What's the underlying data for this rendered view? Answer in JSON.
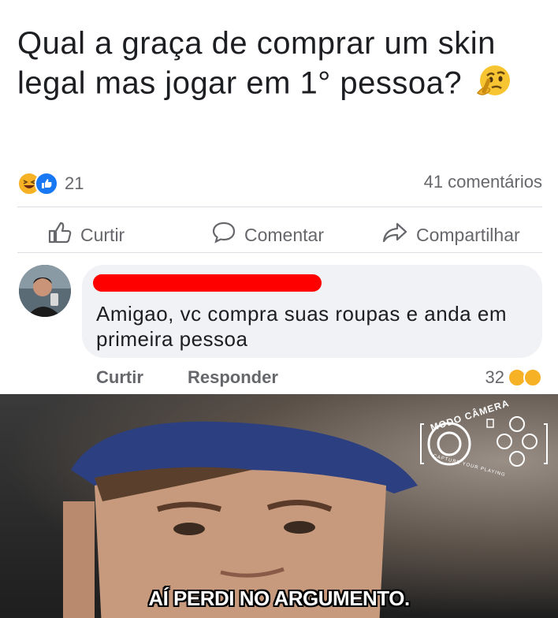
{
  "post": {
    "text": "Qual a graça de comprar um skin legal mas jogar em 1° pessoa?",
    "reactions_count": "21",
    "comments_count": "41 comentários"
  },
  "actions": {
    "like": "Curtir",
    "comment": "Comentar",
    "share": "Compartilhar"
  },
  "comment": {
    "text": "Amigao, vc compra suas roupas e anda em primeira pessoa",
    "like_label": "Curtir",
    "reply_label": "Responder",
    "reactions_count": "32"
  },
  "video": {
    "caption": "AÍ PERDI NO ARGUMENTO.",
    "watermark_title": "MODO CÂMERA",
    "watermark_subtitle": "CAPTURE YOUR PLAYING"
  },
  "colors": {
    "like_blue": "#1877f2",
    "haha_yellow": "#f7b125",
    "redaction_red": "#ff0000",
    "bubble_bg": "#f0f2f5",
    "secondary_text": "#65676b"
  },
  "icons": [
    "haha-reaction-icon",
    "like-reaction-icon",
    "thumbs-up-icon",
    "comment-icon",
    "share-icon",
    "thinking-face-icon",
    "wow-reaction-icon"
  ]
}
